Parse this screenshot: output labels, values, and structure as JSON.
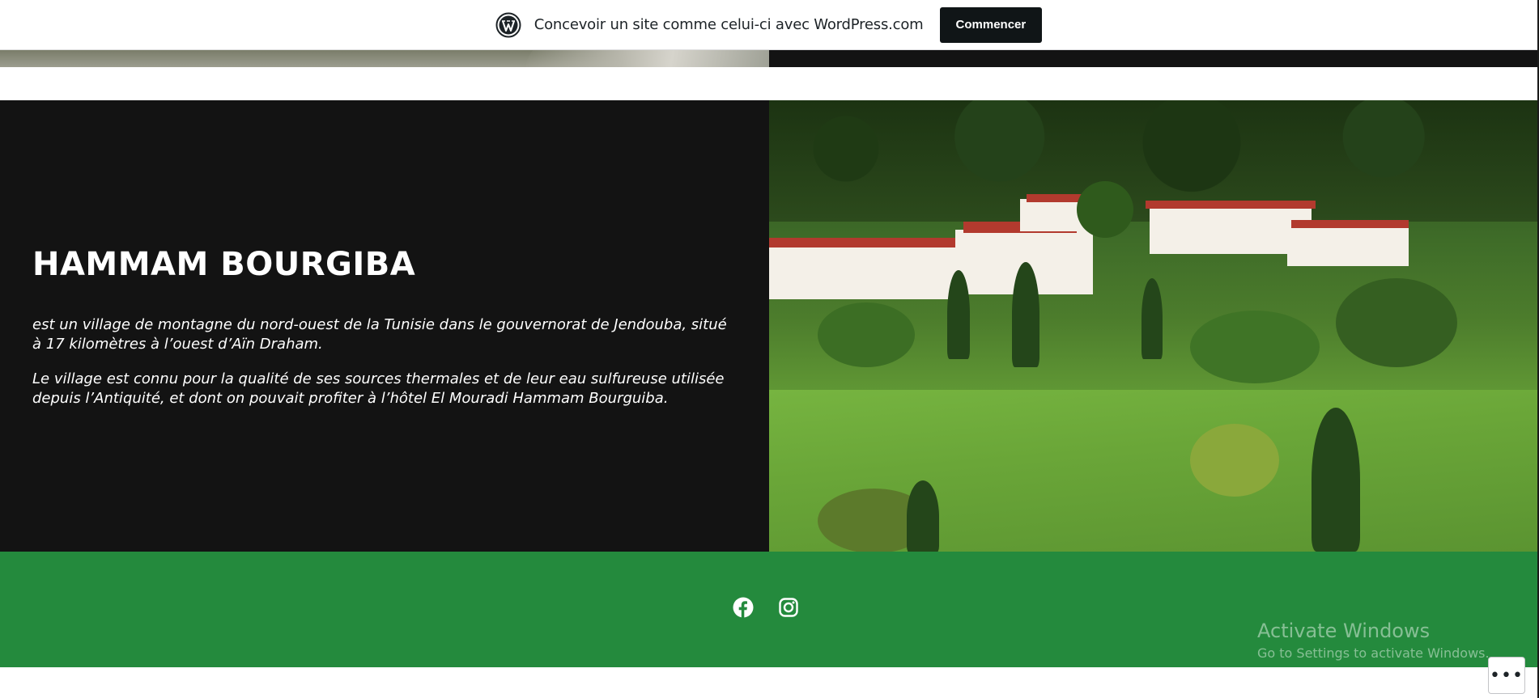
{
  "wp_banner": {
    "text": "Concevoir un site comme celui-ci avec WordPress.com",
    "button_label": "Commencer",
    "logo_icon": "wordpress-logo-icon"
  },
  "feature": {
    "title": "HAMMAM BOURGIBA",
    "paragraph_1": "est un village de montagne du nord-ouest de la Tunisie dans le gouvernorat de Jendouba, situé à 17 kilomètres à l’ouest d’Aïn Draham.",
    "paragraph_2": "Le village est connu pour la qualité de ses sources thermales et de leur eau sulfureuse utilisée depuis l’Antiquité, et dont on pouvait profiter à l’hôtel El Mouradi Hammam Bourguiba.",
    "image_icon": "landscape-photo"
  },
  "footer": {
    "background": "#248a3d",
    "social": [
      {
        "name": "facebook",
        "icon": "facebook-icon"
      },
      {
        "name": "instagram",
        "icon": "instagram-icon"
      }
    ]
  },
  "windows_watermark": {
    "line1": "Activate Windows",
    "line2": "Go to Settings to activate Windows."
  },
  "more_button": {
    "label": "•••",
    "icon": "ellipsis-icon"
  },
  "colors": {
    "dark_panel": "#131313",
    "wp_button": "#101517",
    "footer_green": "#248a3d"
  }
}
